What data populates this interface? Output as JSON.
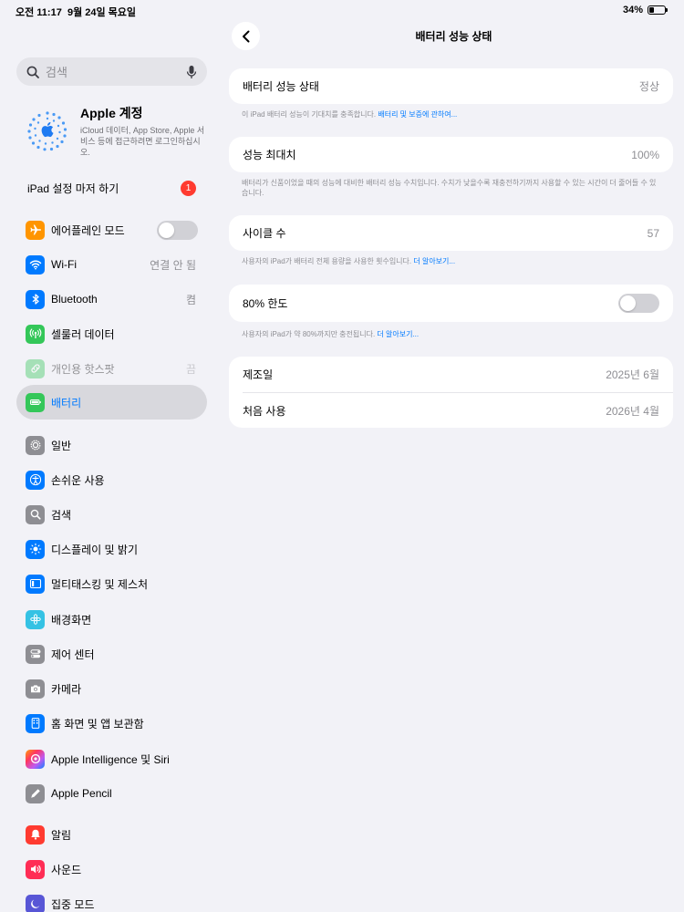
{
  "status": {
    "time": "오전 11:17",
    "date": "9월 24일 목요일",
    "battery": "34%",
    "battery_level": 0.34
  },
  "sidebar": {
    "search_placeholder": "검색",
    "account": {
      "title": "Apple 계정",
      "subtitle": "iCloud 데이터, App Store, Apple 서비스 등에 접근하려면 로그인하십시오."
    },
    "setup": {
      "label": "iPad 설정 마저 하기",
      "badge": "1"
    },
    "items": [
      {
        "label": "에어플레인 모드",
        "icon": "airplane-icon",
        "color": "#ff9500"
      },
      {
        "label": "Wi-Fi",
        "value": "연결 안 됨",
        "icon": "wifi-icon",
        "color": "#007aff"
      },
      {
        "label": "Bluetooth",
        "value": "켬",
        "icon": "bluetooth-icon",
        "color": "#007aff"
      },
      {
        "label": "셀룰러 데이터",
        "icon": "cellular-icon",
        "color": "#34c759"
      },
      {
        "label": "개인용 핫스팟",
        "value": "끔",
        "icon": "hotspot-icon",
        "color": "#34c759"
      },
      {
        "label": "배터리",
        "icon": "battery-icon",
        "color": "#34c759"
      },
      {
        "label": "일반",
        "icon": "gear-icon",
        "color": "#8e8e93"
      },
      {
        "label": "손쉬운 사용",
        "icon": "accessibility-icon",
        "color": "#007aff"
      },
      {
        "label": "검색",
        "icon": "search-icon",
        "color": "#8e8e93"
      },
      {
        "label": "디스플레이 및 밝기",
        "icon": "brightness-icon",
        "color": "#007aff"
      },
      {
        "label": "멀티태스킹 및 제스처",
        "icon": "multitasking-icon",
        "color": "#007aff"
      },
      {
        "label": "배경화면",
        "icon": "wallpaper-icon",
        "color": "#35c2e4"
      },
      {
        "label": "제어 센터",
        "icon": "control-center-icon",
        "color": "#8e8e93"
      },
      {
        "label": "카메라",
        "icon": "camera-icon",
        "color": "#8e8e93"
      },
      {
        "label": "홈 화면 및 앱 보관함",
        "icon": "home-screen-icon",
        "color": "#007aff"
      },
      {
        "label": "Apple Intelligence 및 Siri",
        "icon": "siri-icon",
        "color": "#ff6b9a"
      },
      {
        "label": "Apple Pencil",
        "icon": "pencil-icon",
        "color": "#8e8e93"
      },
      {
        "label": "알림",
        "icon": "bell-icon",
        "color": "#ff3b30"
      },
      {
        "label": "사운드",
        "icon": "speaker-icon",
        "color": "#ff2d55"
      },
      {
        "label": "집중 모드",
        "icon": "moon-icon",
        "color": "#5856d6"
      }
    ]
  },
  "main": {
    "title": "배터리 성능 상태",
    "health": {
      "label": "배터리 성능 상태",
      "value": "정상"
    },
    "health_note": "이 iPad 배터리 성능이 기대치를 충족합니다.",
    "health_link": "배터리 및 보증에 관하여...",
    "capacity": {
      "label": "성능 최대치",
      "value": "100%"
    },
    "capacity_note": "배터리가 신품이었을 때의 성능에 대비한 배터리 성능 수치입니다. 수치가 낮을수록 재충전하기까지 사용할 수 있는 시간이 더 줄어들 수 있습니다.",
    "cycle": {
      "label": "사이클 수",
      "value": "57"
    },
    "cycle_note": "사용자의 iPad가 배터리 전체 용량을 사용한 횟수입니다.",
    "cycle_link": "더 알아보기...",
    "limit": {
      "label": "80% 한도"
    },
    "limit_note": "사용자의 iPad가 약 80%까지만 충전됩니다.",
    "limit_link": "더 알아보기...",
    "manufactured": {
      "label": "제조일",
      "value": "2025년 6월"
    },
    "first_use": {
      "label": "처음 사용",
      "value": "2026년 4월"
    }
  }
}
